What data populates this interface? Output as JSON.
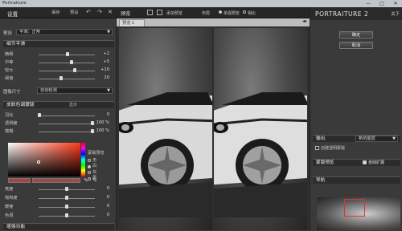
{
  "window": {
    "title": "Portraiture",
    "controls": [
      "—",
      "□",
      "✕"
    ]
  },
  "left": {
    "header": {
      "title": "设置",
      "btn1": "保存",
      "btn2": "预设"
    },
    "preset": {
      "label": "预设",
      "value": "平滑：正常"
    },
    "smooth_section": "细节平滑",
    "smooth_sliders": [
      {
        "label": "精细",
        "value": "+2",
        "pos": 0.52
      },
      {
        "label": "中等",
        "value": "+5",
        "pos": 0.58
      },
      {
        "label": "较大",
        "value": "+10",
        "pos": 0.64
      },
      {
        "label": "阈值",
        "value": "20",
        "pos": 0.4
      }
    ],
    "image_size": {
      "label": "图像尺寸",
      "value": "自动检测"
    },
    "skin_section": {
      "title": "皮肤色调蒙版",
      "extra": "显示"
    },
    "skin_sliders": [
      {
        "label": "羽化",
        "value": "0",
        "pos": 0.02
      },
      {
        "label": "透明度",
        "value": "100 %",
        "pos": 0.95
      },
      {
        "label": "模糊",
        "value": "100 %",
        "pos": 0.95
      }
    ],
    "mask_radios": {
      "label": "蒙版预览",
      "items": [
        "无",
        "白",
        "灰",
        "黑"
      ],
      "selected": 1
    },
    "tone_sliders": [
      {
        "label": "亮度",
        "value": "0",
        "pos": 0.5
      },
      {
        "label": "饱和度",
        "value": "0",
        "pos": 0.5
      },
      {
        "label": "暖度",
        "value": "0",
        "pos": 0.5
      },
      {
        "label": "色调",
        "value": "0",
        "pos": 0.5
      }
    ],
    "bottom_hint": "增强功能"
  },
  "center": {
    "title": "预览",
    "toolbar": {
      "add": "添加预览",
      "layout": "布局",
      "opt1": "单视预览",
      "opt2": "相比"
    },
    "tab": "预览 1"
  },
  "right": {
    "brand": "PORTRAITURE 2",
    "help": "关于",
    "ok": "确定",
    "cancel": "取消",
    "output": {
      "label": "输出",
      "value": "新的图层"
    },
    "mask_checkbox": "创建透明蒙版",
    "mask_preview": {
      "label": "蒙版预览",
      "auto": "自动扩展"
    },
    "navigator": "导航"
  },
  "colors": {
    "accent": "#e83030"
  }
}
